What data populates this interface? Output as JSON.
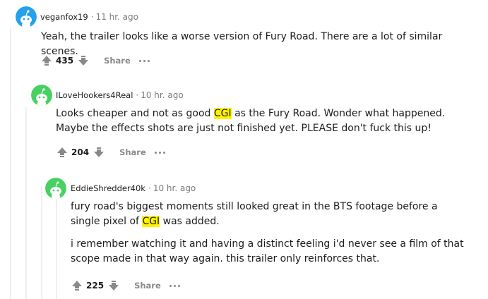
{
  "colors": {
    "avatar_1": "#46d160",
    "avatar_2": "#46d160",
    "avatar_3": "#46d160",
    "avatar_top": "#24a0ed",
    "highlight": "#fff000",
    "vote_icon": "#878a8c"
  },
  "comments": [
    {
      "username": "veganfox19",
      "time": "11 hr. ago",
      "paragraphs": [
        [
          "Yeah, the trailer looks like a worse version of Fury Road. There are a lot of similar scenes."
        ]
      ],
      "score": "435",
      "share_label": "Share",
      "avatar_icon": "snoo-avatar-icon"
    },
    {
      "username": "ILoveHookers4Real",
      "time": "10 hr. ago",
      "paragraphs": [
        [
          "Looks cheaper and not as good ",
          "CGI",
          " as the Fury Road. Wonder what happened. Maybe the effects shots are just not finished yet. PLEASE don't fuck this up!"
        ]
      ],
      "score": "204",
      "share_label": "Share",
      "avatar_icon": "snoo-avatar-icon"
    },
    {
      "username": "EddieShredder40k",
      "time": "10 hr. ago",
      "paragraphs": [
        [
          "fury road's biggest moments still looked great in the BTS footage before a single pixel of ",
          "CGI",
          " was added."
        ],
        [
          "i remember watching it and having a distinct feeling i'd never see a film of that scope made in that way again. this trailer only reinforces that."
        ]
      ],
      "score": "225",
      "share_label": "Share",
      "avatar_icon": "snoo-avatar-icon"
    }
  ],
  "separator": "·"
}
